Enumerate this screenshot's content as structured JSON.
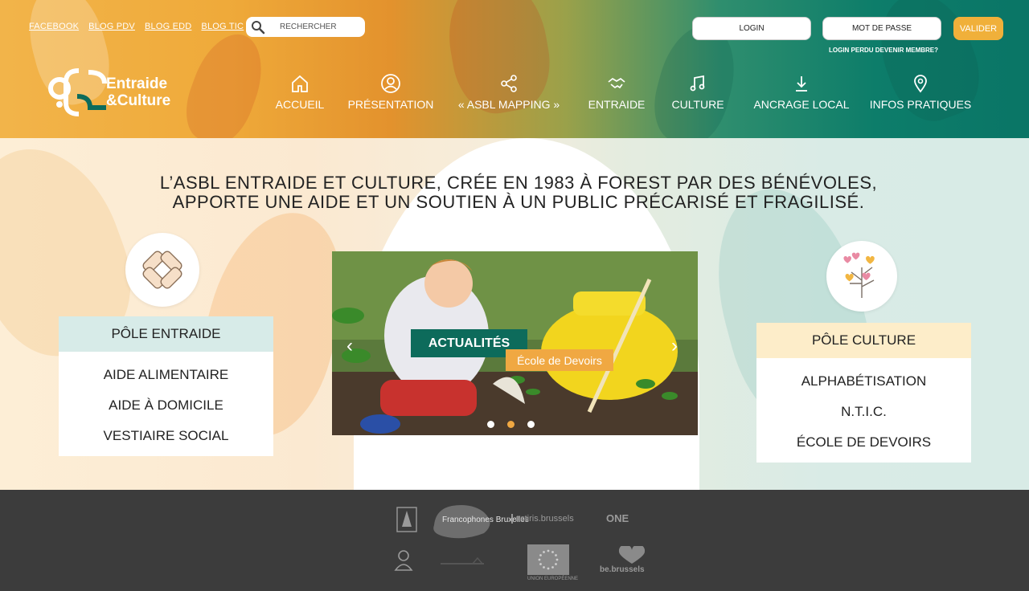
{
  "top_links": [
    "FACEBOOK",
    "BLOG PDV",
    "BLOG EDD",
    "BLOG TIC"
  ],
  "search": {
    "placeholder": "RECHERCHER"
  },
  "auth": {
    "login_placeholder": "LOGIN",
    "password_placeholder": "MOT DE PASSE",
    "submit_label": "VALIDER",
    "help_text": "LOGIN PERDU DEVENIR MEMBRE?"
  },
  "logo": {
    "line1": "Entraide",
    "line2": "&Culture"
  },
  "nav": [
    {
      "label": "ACCUEIL",
      "icon": "home-icon"
    },
    {
      "label": "PRÉSENTATION",
      "icon": "user-circle-icon"
    },
    {
      "label": "« ASBL MAPPING »",
      "icon": "share-icon"
    },
    {
      "label": "ENTRAIDE",
      "icon": "handshake-icon"
    },
    {
      "label": "CULTURE",
      "icon": "music-note-icon"
    },
    {
      "label": "ANCRAGE LOCAL",
      "icon": "download-icon"
    },
    {
      "label": "INFOS PRATIQUES",
      "icon": "map-pin-icon"
    }
  ],
  "tagline": {
    "line1": "L’ASBL ENTRAIDE ET CULTURE, CRÉE EN 1983 À FOREST PAR DES BÉNÉVOLES,",
    "line2": "APPORTE UNE AIDE ET UN SOUTIEN À UN PUBLIC PRÉCARISÉ ET FRAGILISÉ."
  },
  "pole_entraide": {
    "title": "PÔLE ENTRAIDE",
    "items": [
      "AIDE ALIMENTAIRE",
      "AIDE À DOMICILE",
      "VESTIAIRE SOCIAL"
    ]
  },
  "pole_culture": {
    "title": "PÔLE CULTURE",
    "items": [
      "ALPHABÉTISATION",
      "N.T.I.C.",
      "ÉCOLE DE DEVOIRS"
    ]
  },
  "slider": {
    "badge": "ACTUALITÉS",
    "subtitle": "École de Devoirs",
    "prev": "‹",
    "next": "›",
    "slide_count": 3,
    "active_index": 2
  },
  "footer_logos": [
    "Francophones Bruxelles",
    "actiris.brussels",
    "ONE",
    "UNION EUROPÉENNE",
    "be.brussels"
  ],
  "colors": {
    "accent_orange": "#f0b03a",
    "teal": "#0d6b5b",
    "entraide_header": "#d7ebe8",
    "culture_header": "#fdedc9",
    "footer": "#3c3c3c"
  }
}
